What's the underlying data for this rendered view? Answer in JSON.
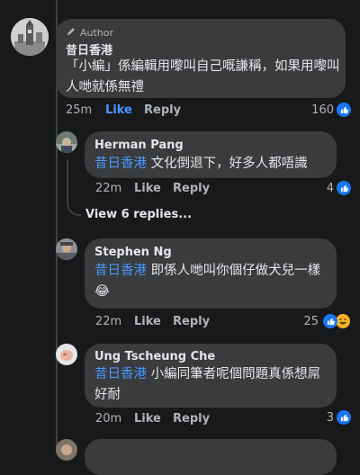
{
  "comments": [
    {
      "badge": "Author",
      "author": "昔日香港",
      "text": "「小編」係編輯用嚟叫自己嘅謙稱，如果用嚟叫人哋就係無禮",
      "time": "25m",
      "like_label": "Like",
      "reply_label": "Reply",
      "reaction_count": "160",
      "reaction_icons": [
        "like-icon"
      ]
    },
    {
      "author": "Herman Pang",
      "mention": "昔日香港",
      "text": " 文化倒退下，好多人都唔識",
      "time": "22m",
      "like_label": "Like",
      "reply_label": "Reply",
      "reaction_count": "4",
      "reaction_icons": [
        "like-icon"
      ]
    },
    {
      "view_replies": "View 6 replies..."
    },
    {
      "author": "Stephen Ng",
      "mention": "昔日香港",
      "text": " 即係人哋叫你個仔做犬兒一樣",
      "emoji": "😂",
      "time": "22m",
      "like_label": "Like",
      "reply_label": "Reply",
      "reaction_count": "25",
      "reaction_icons": [
        "like-icon",
        "haha-icon"
      ]
    },
    {
      "author": "Ung Tscheung Che",
      "mention": "昔日香港",
      "text": " 小編同筆者呢個問題真係想屌好耐",
      "time": "20m",
      "like_label": "Like",
      "reply_label": "Reply",
      "reaction_count": "3",
      "reaction_icons": [
        "like-icon"
      ]
    }
  ],
  "colors": {
    "background": "#18191a",
    "bubble": "#3a3b3c",
    "mention": "#4599ff",
    "secondary_text": "#b0b3b8",
    "like_blue": "#1877f2",
    "active_like": "#4599ff"
  }
}
